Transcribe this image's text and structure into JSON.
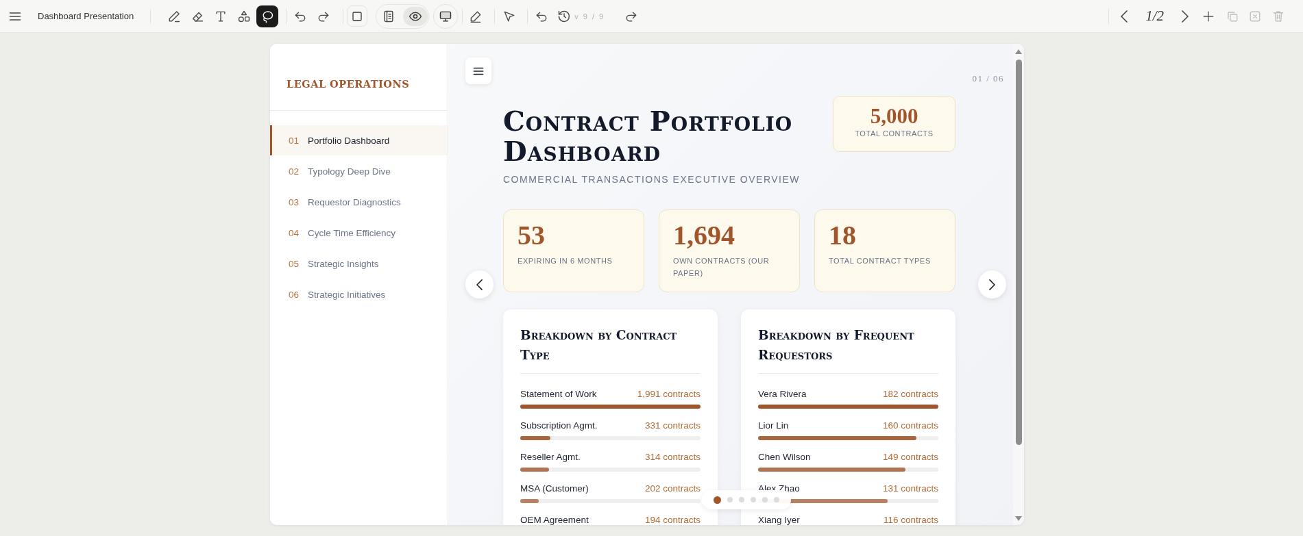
{
  "toolbar": {
    "title": "Dashboard Presentation",
    "tools": [
      {
        "selected": false
      },
      {
        "selected": false
      },
      {
        "selected": false
      },
      {
        "selected": false
      },
      {
        "selected": true
      }
    ],
    "view_modes": [
      {
        "selected": false
      },
      {
        "selected": true
      }
    ],
    "version": "v 9 / 9",
    "page_indicator": "1/2",
    "page_actions": [
      {
        "disabled": false
      },
      {
        "disabled": true
      },
      {
        "disabled": true
      },
      {
        "disabled": true
      }
    ]
  },
  "sidebar": {
    "heading": "LEGAL OPERATIONS",
    "items": [
      {
        "number": "01",
        "label": "Portfolio Dashboard",
        "selected": true
      },
      {
        "number": "02",
        "label": "Typology Deep Dive",
        "selected": false
      },
      {
        "number": "03",
        "label": "Requestor Diagnostics",
        "selected": false
      },
      {
        "number": "04",
        "label": "Cycle Time Efficiency",
        "selected": false
      },
      {
        "number": "05",
        "label": "Strategic Insights",
        "selected": false
      },
      {
        "number": "06",
        "label": "Strategic Initiatives",
        "selected": false
      }
    ]
  },
  "slide": {
    "counter": "01 / 06",
    "title": "Contract Portfolio Dashboard",
    "subtitle": "COMMERCIAL TRANSACTIONS EXECUTIVE OVERVIEW",
    "total": {
      "value": "5,000",
      "label": "TOTAL CONTRACTS"
    },
    "stats": [
      {
        "value": "53",
        "label": "EXPIRING IN 6 MONTHS"
      },
      {
        "value": "1,694",
        "label": "OWN CONTRACTS (OUR PAPER)"
      },
      {
        "value": "18",
        "label": "TOTAL CONTRACT TYPES"
      }
    ],
    "panels": [
      {
        "title": "Breakdown by Contract Type",
        "rows": [
          {
            "label": "Statement of Work",
            "value": "1,991 contracts",
            "level": 1.0
          },
          {
            "label": "Subscription Agmt.",
            "value": "331 contracts",
            "level": 0.166
          },
          {
            "label": "Reseller Agmt.",
            "value": "314 contracts",
            "level": 0.158
          },
          {
            "label": "MSA (Customer)",
            "value": "202 contracts",
            "level": 0.101
          },
          {
            "label": "OEM Agreement",
            "value": "194 contracts"
          }
        ]
      },
      {
        "title": "Breakdown by Frequent Requestors",
        "rows": [
          {
            "label": "Vera Rivera",
            "value": "182 contracts",
            "level": 1.0
          },
          {
            "label": "Lior Lin",
            "value": "160 contracts",
            "level": 0.879
          },
          {
            "label": "Chen Wilson",
            "value": "149 contracts",
            "level": 0.819
          },
          {
            "label": "Alex Zhao",
            "value": "131 contracts",
            "level": 0.72
          },
          {
            "label": "Xiang Iyer",
            "value": "116 contracts"
          }
        ]
      }
    ],
    "pagination": [
      {
        "selected": true
      },
      {
        "selected": false
      },
      {
        "selected": false
      },
      {
        "selected": false
      },
      {
        "selected": false
      },
      {
        "selected": false
      }
    ]
  }
}
